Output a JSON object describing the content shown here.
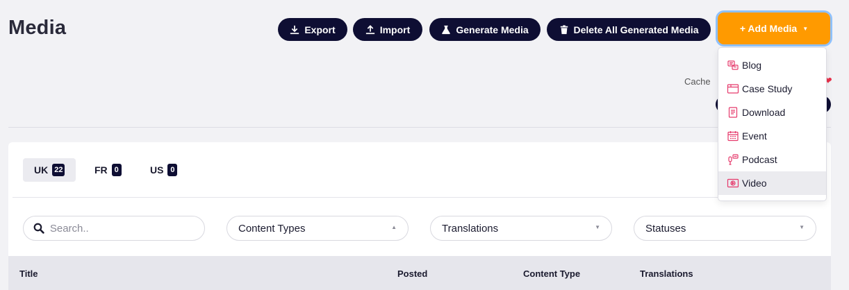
{
  "header": {
    "title": "Media",
    "actions": {
      "export": "Export",
      "import": "Import",
      "generate": "Generate Media",
      "delete_generated": "Delete All Generated Media",
      "add_media": "+ Add Media"
    }
  },
  "cache": {
    "label": "Cache"
  },
  "add_menu": {
    "items": [
      {
        "label": "Blog",
        "icon": "blog-icon"
      },
      {
        "label": "Case Study",
        "icon": "case-study-icon"
      },
      {
        "label": "Download",
        "icon": "download-doc-icon"
      },
      {
        "label": "Event",
        "icon": "calendar-icon"
      },
      {
        "label": "Podcast",
        "icon": "podcast-icon"
      },
      {
        "label": "Video",
        "icon": "video-icon"
      }
    ],
    "hovered": "Video"
  },
  "locales": [
    {
      "label": "UK",
      "count": "22",
      "active": true
    },
    {
      "label": "FR",
      "count": "0",
      "active": false
    },
    {
      "label": "US",
      "count": "0",
      "active": false
    }
  ],
  "filters": {
    "search_placeholder": "Search..",
    "content_types": "Content Types",
    "translations": "Translations",
    "statuses": "Statuses"
  },
  "table": {
    "columns": [
      "Title",
      "Posted",
      "Content Type",
      "Translations"
    ]
  },
  "colors": {
    "primary_dark": "#0e0e33",
    "accent_orange": "#ff9a00",
    "icon_pink": "#e5396b"
  }
}
